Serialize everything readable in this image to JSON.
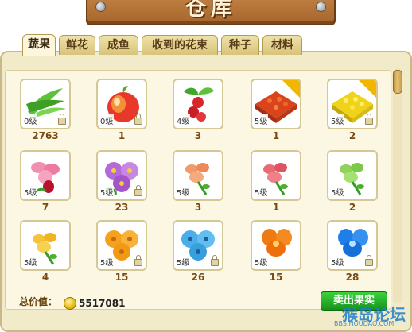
{
  "header": {
    "title": "仓库"
  },
  "tabs": [
    {
      "label": "蔬果",
      "active": true
    },
    {
      "label": "鲜花"
    },
    {
      "label": "成鱼"
    },
    {
      "label": "收到的花束"
    },
    {
      "label": "种子"
    },
    {
      "label": "材料"
    }
  ],
  "items": [
    {
      "name": "grass-bundle",
      "level": "0级",
      "qty": "2763",
      "locked": true
    },
    {
      "name": "peach",
      "level": "0级",
      "qty": "1",
      "locked": true
    },
    {
      "name": "red-berries",
      "level": "4级",
      "qty": "3",
      "locked": false
    },
    {
      "name": "red-flower-bed",
      "level": "5级",
      "qty": "1",
      "locked": false,
      "badge": true
    },
    {
      "name": "yellow-flower-bed",
      "level": "5级",
      "qty": "2",
      "locked": true,
      "badge": true
    },
    {
      "name": "pink-orchid",
      "level": "5级",
      "qty": "7",
      "locked": false
    },
    {
      "name": "purple-bouquet",
      "level": "5级",
      "qty": "23",
      "locked": true
    },
    {
      "name": "orange-lily",
      "level": "5级",
      "qty": "3",
      "locked": false
    },
    {
      "name": "red-lily",
      "level": "5级",
      "qty": "1",
      "locked": false
    },
    {
      "name": "green-lily",
      "level": "5级",
      "qty": "2",
      "locked": false
    },
    {
      "name": "yellow-lily",
      "level": "5级",
      "qty": "4",
      "locked": false
    },
    {
      "name": "orange-bouquet",
      "level": "5级",
      "qty": "15",
      "locked": true
    },
    {
      "name": "blue-bouquet",
      "level": "5级",
      "qty": "26",
      "locked": true
    },
    {
      "name": "orange-poppy",
      "level": "5级",
      "qty": "15",
      "locked": false
    },
    {
      "name": "blue-poppy",
      "level": "5级",
      "qty": "28",
      "locked": true
    }
  ],
  "footer": {
    "total_label": "总价值：",
    "total_value": "5517081",
    "sell_button": "卖出果实"
  },
  "watermark": {
    "text": "猴岛论坛",
    "url": "BBS.HOUDAO.COM"
  },
  "colors": {
    "panel_bg": "#f2ebc9",
    "qty_text": "#7a4a12",
    "sell_button": "#16931a"
  }
}
